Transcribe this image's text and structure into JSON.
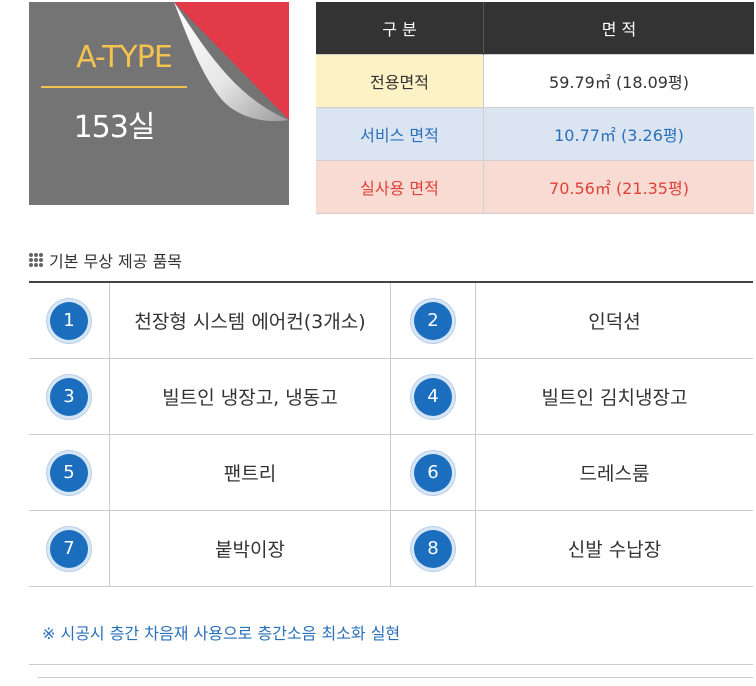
{
  "unit_type": {
    "name": "A-TYPE",
    "count": "153실",
    "colors": {
      "background": "#747474",
      "accent": "#f4c24e",
      "corner": "#e23a48"
    }
  },
  "area_table": {
    "headers": [
      "구 분",
      "면 적"
    ],
    "rows": [
      {
        "label": "전용면적",
        "value": "59.79㎡ (18.09평)"
      },
      {
        "label": "서비스 면적",
        "value": "10.77㎡ (3.26평)"
      },
      {
        "label": "실사용 면적",
        "value": "70.56㎡ (21.35평)"
      }
    ]
  },
  "options_section": {
    "title": "기본 무상 제공 품목",
    "icon": "dots-grid-icon",
    "items": [
      {
        "num": "1",
        "label": "천장형 시스템 에어컨(3개소)"
      },
      {
        "num": "2",
        "label": "인덕션"
      },
      {
        "num": "3",
        "label": "빌트인 냉장고, 냉동고"
      },
      {
        "num": "4",
        "label": "빌트인 김치냉장고"
      },
      {
        "num": "5",
        "label": "팬트리"
      },
      {
        "num": "6",
        "label": "드레스룸"
      },
      {
        "num": "7",
        "label": "붙박이장"
      },
      {
        "num": "8",
        "label": "신발 수납장"
      }
    ]
  },
  "note": "※ 시공시 층간 차음재 사용으로 층간소음 최소화 실현"
}
